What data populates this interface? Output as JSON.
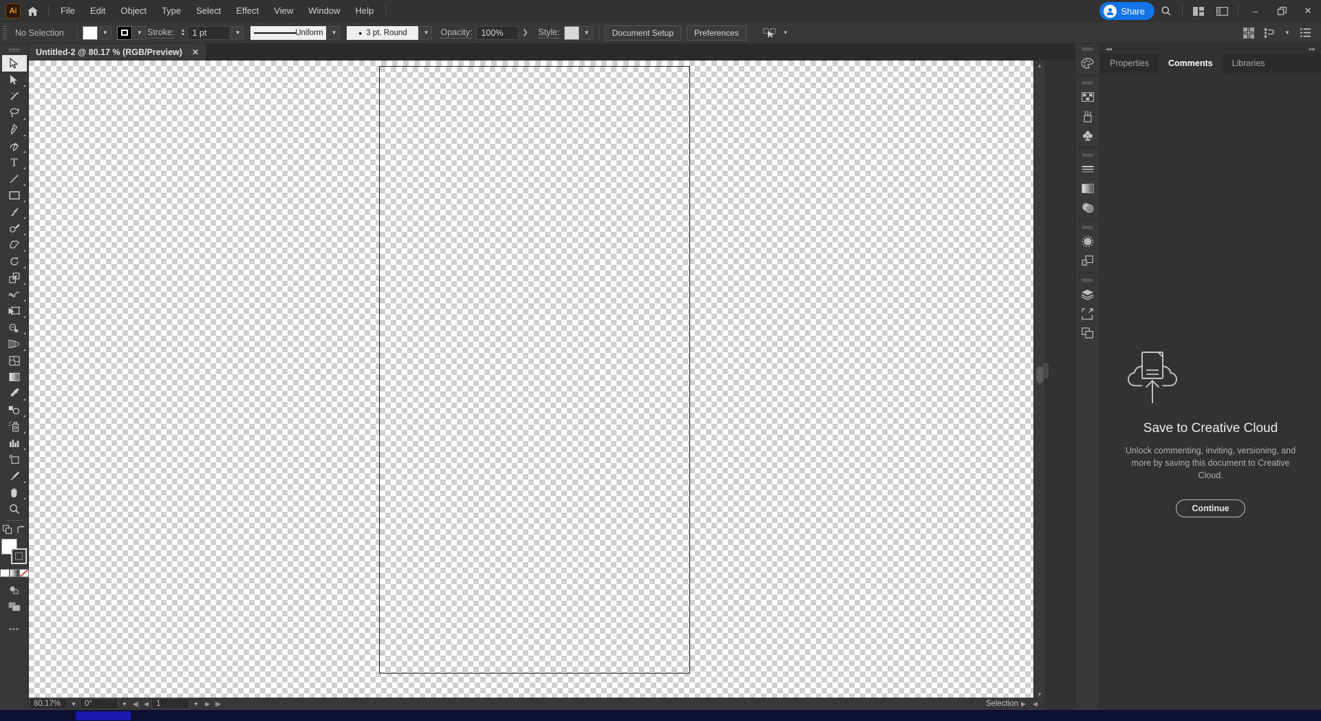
{
  "app": {
    "name": "Adobe Illustrator",
    "logo_text": "Ai"
  },
  "menubar": {
    "items": [
      {
        "label": "File"
      },
      {
        "label": "Edit"
      },
      {
        "label": "Object"
      },
      {
        "label": "Type"
      },
      {
        "label": "Select"
      },
      {
        "label": "Effect"
      },
      {
        "label": "View"
      },
      {
        "label": "Window"
      },
      {
        "label": "Help"
      }
    ],
    "share_label": "Share"
  },
  "window_controls": {
    "minimize": "–",
    "maximize": "❐",
    "close": "✕"
  },
  "control_bar": {
    "selection_status": "No Selection",
    "stroke_label": "Stroke:",
    "stroke_weight": "1 pt",
    "stroke_profile": "Uniform",
    "brush_definition": "3 pt. Round",
    "opacity_label": "Opacity:",
    "opacity_value": "100%",
    "style_label": "Style:",
    "document_setup_label": "Document Setup",
    "preferences_label": "Preferences"
  },
  "document_tab": {
    "title": "Untitled-2 @ 80.17 % (RGB/Preview)",
    "close_glyph": "✕"
  },
  "toolbar": {
    "tools": [
      {
        "name": "selection-tool"
      },
      {
        "name": "direct-selection-tool"
      },
      {
        "name": "magic-wand-tool"
      },
      {
        "name": "lasso-tool"
      },
      {
        "name": "pen-tool"
      },
      {
        "name": "curvature-tool"
      },
      {
        "name": "type-tool"
      },
      {
        "name": "line-segment-tool"
      },
      {
        "name": "rectangle-tool"
      },
      {
        "name": "paintbrush-tool"
      },
      {
        "name": "shaper-tool"
      },
      {
        "name": "eraser-tool"
      },
      {
        "name": "rotate-tool"
      },
      {
        "name": "scale-tool"
      },
      {
        "name": "free-transform-tool"
      },
      {
        "name": "width-tool"
      },
      {
        "name": "shape-builder-tool"
      },
      {
        "name": "perspective-grid-tool"
      },
      {
        "name": "mesh-tool"
      },
      {
        "name": "gradient-tool"
      },
      {
        "name": "eyedropper-tool"
      },
      {
        "name": "blend-tool"
      },
      {
        "name": "symbol-sprayer-tool"
      },
      {
        "name": "column-graph-tool"
      },
      {
        "name": "artboard-tool"
      },
      {
        "name": "slice-tool"
      },
      {
        "name": "hand-tool"
      },
      {
        "name": "zoom-tool"
      }
    ],
    "more_tools_glyph": "•••",
    "fill_color": "#ffffff",
    "stroke_color": "#000000"
  },
  "status_bar": {
    "zoom_level": "80.17%",
    "rotation": "0°",
    "artboard_number": "1",
    "tool_status": "Selection"
  },
  "dock_rail": {
    "icons": [
      {
        "name": "color-panel-icon"
      },
      {
        "name": "swatches-panel-icon"
      },
      {
        "name": "brushes-panel-icon"
      },
      {
        "name": "symbols-panel-icon"
      },
      {
        "name": "stroke-panel-icon"
      },
      {
        "name": "gradient-panel-icon"
      },
      {
        "name": "transparency-panel-icon"
      },
      {
        "name": "appearance-panel-icon"
      },
      {
        "name": "graphic-styles-panel-icon"
      },
      {
        "name": "layers-panel-icon"
      },
      {
        "name": "artboards-panel-icon"
      },
      {
        "name": "asset-export-panel-icon"
      }
    ]
  },
  "panel": {
    "tabs": [
      {
        "label": "Properties",
        "active": false
      },
      {
        "label": "Comments",
        "active": true
      },
      {
        "label": "Libraries",
        "active": false
      }
    ],
    "comments": {
      "icon": "cloud-upload-icon",
      "title": "Save to Creative Cloud",
      "description": "Unlock commenting, inviting, versioning, and more by saving this document to Creative Cloud.",
      "button_label": "Continue"
    },
    "collapse_left_glyph": "◂◂",
    "collapse_right_glyph": "▸▸"
  },
  "canvas": {
    "artboard_label": "artboard-1",
    "background": "transparency-checkerboard"
  },
  "colors": {
    "accent_blue": "#1473e6",
    "chrome_dark": "#323232",
    "chrome_mid": "#383838",
    "chrome_light": "#4a4a4a",
    "text_primary": "#d0d0d0"
  }
}
